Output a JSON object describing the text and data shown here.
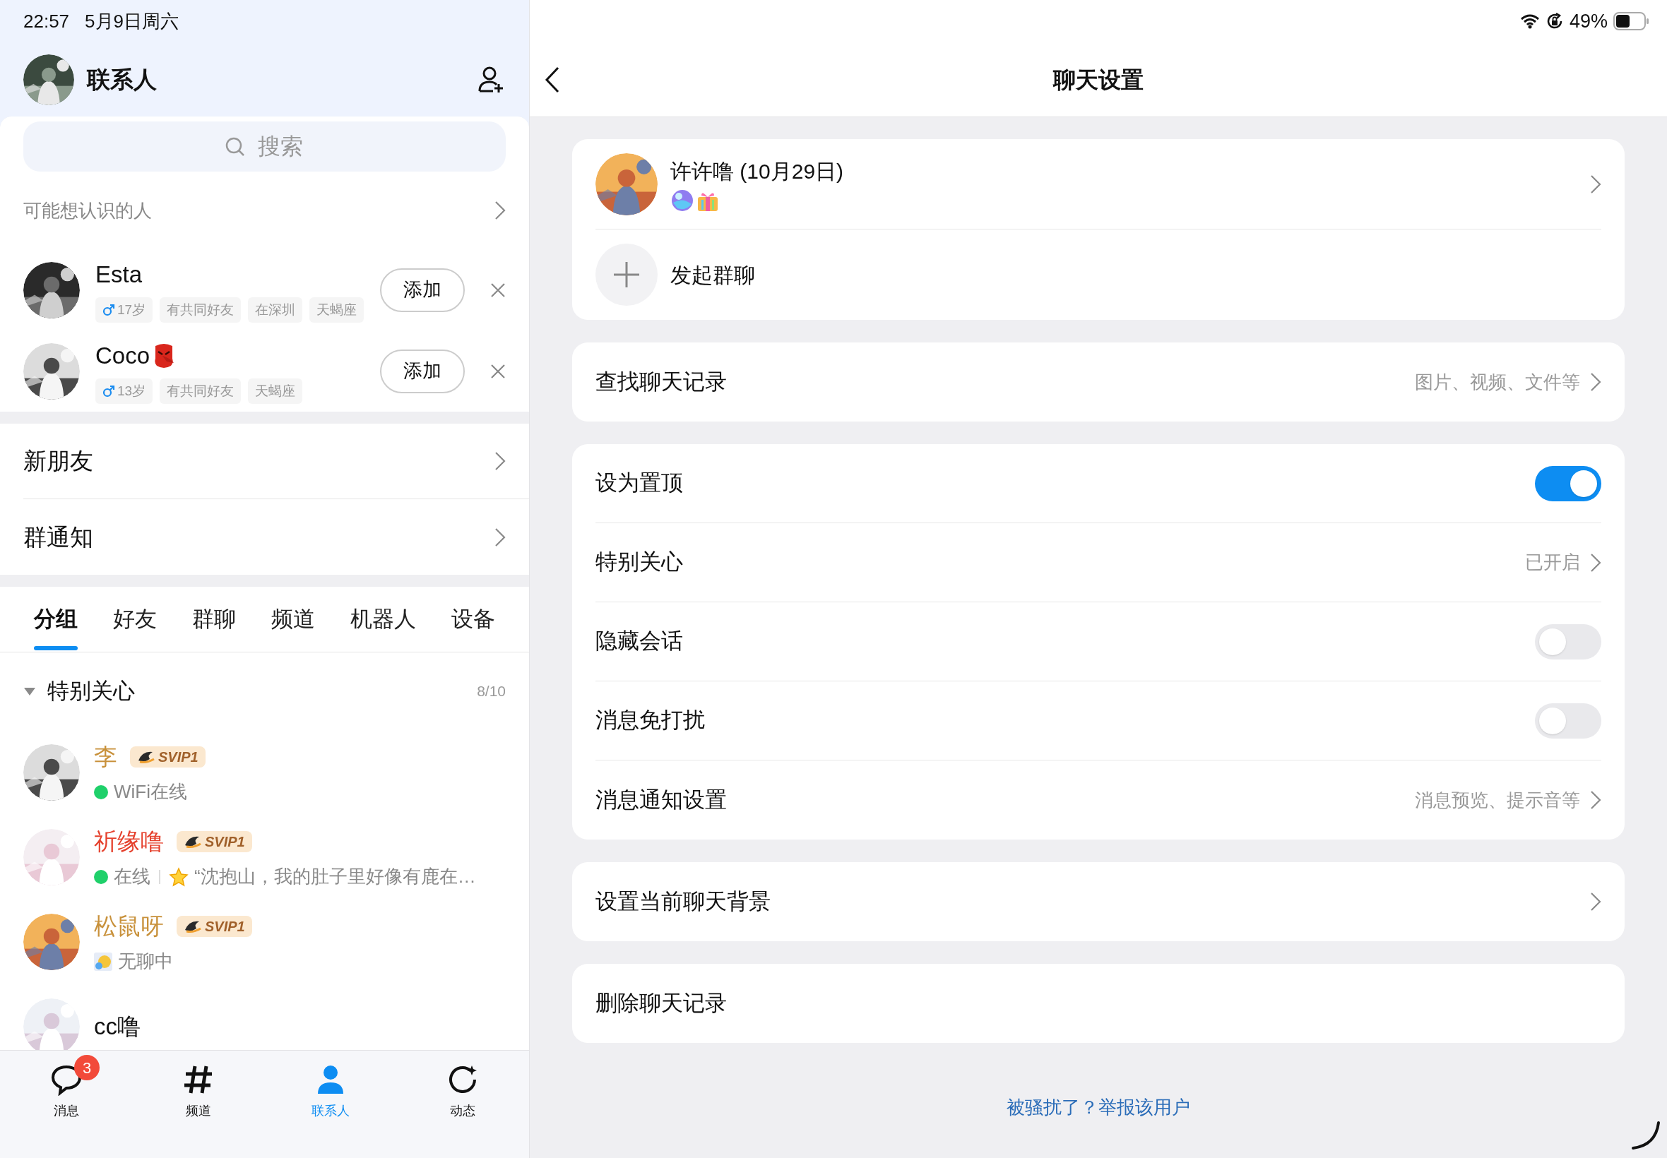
{
  "status_bar": {
    "time": "22:57",
    "date": "5月9日周六",
    "battery_text": "49%"
  },
  "contacts_panel": {
    "title": "联系人",
    "search": {
      "placeholder": "搜索"
    },
    "suggestions": {
      "title": "可能想认识的人",
      "people": [
        {
          "name": "Esta",
          "emoji": false,
          "tags": [
            {
              "kind": "gender",
              "text": "17岁"
            },
            {
              "kind": "plain",
              "text": "有共同好友"
            },
            {
              "kind": "plain",
              "text": "在深圳"
            },
            {
              "kind": "plain",
              "text": "天蝎座"
            }
          ],
          "button": "添加"
        },
        {
          "name": "Coco",
          "emoji": true,
          "tags": [
            {
              "kind": "gender",
              "text": "13岁"
            },
            {
              "kind": "plain",
              "text": "有共同好友"
            },
            {
              "kind": "plain",
              "text": "天蝎座"
            }
          ],
          "button": "添加"
        }
      ]
    },
    "links": [
      {
        "label": "新朋友"
      },
      {
        "label": "群通知"
      }
    ],
    "tabs": [
      {
        "label": "分组",
        "selected": true
      },
      {
        "label": "好友",
        "selected": false
      },
      {
        "label": "群聊",
        "selected": false
      },
      {
        "label": "频道",
        "selected": false
      },
      {
        "label": "机器人",
        "selected": false
      },
      {
        "label": "设备",
        "selected": false
      }
    ],
    "group": {
      "name": "特别关心",
      "count": "8/10",
      "expanded": true,
      "contacts": [
        {
          "name": "李",
          "color": "#c8913b",
          "badge": "SVIP1",
          "status": {
            "kind": "online",
            "text": "WiFi在线"
          }
        },
        {
          "name": "祈缘噜",
          "color": "#e5402c",
          "badge": "SVIP1",
          "status": {
            "kind": "online",
            "text": "在线",
            "signature": "“沈抱山，我的肚子里好像有鹿在…"
          }
        },
        {
          "name": "松鼠呀",
          "color": "#c8913b",
          "badge": "SVIP1",
          "status": {
            "kind": "sleepy",
            "text": "无聊中"
          }
        },
        {
          "name": "cc噜",
          "color": "#111111"
        }
      ]
    }
  },
  "tab_bar": [
    {
      "label": "消息",
      "badge": "3",
      "selected": false
    },
    {
      "label": "频道",
      "selected": false
    },
    {
      "label": "联系人",
      "selected": true
    },
    {
      "label": "动态",
      "selected": false
    }
  ],
  "chat_settings": {
    "title": "聊天设置",
    "groups": [
      [
        {
          "kind": "profile",
          "name": "许许噜 (10月29日)"
        },
        {
          "kind": "action",
          "label": "发起群聊"
        }
      ],
      [
        {
          "kind": "link",
          "label": "查找聊天记录",
          "hint": "图片、视频、文件等"
        }
      ],
      [
        {
          "kind": "toggle",
          "label": "设为置顶",
          "on": true
        },
        {
          "kind": "link",
          "label": "特别关心",
          "hint": "已开启"
        },
        {
          "kind": "toggle",
          "label": "隐藏会话",
          "on": false
        },
        {
          "kind": "toggle",
          "label": "消息免打扰",
          "on": false
        },
        {
          "kind": "link",
          "label": "消息通知设置",
          "hint": "消息预览、提示音等"
        }
      ],
      [
        {
          "kind": "link",
          "label": "设置当前聊天背景"
        }
      ],
      [
        {
          "kind": "plain",
          "label": "删除聊天记录"
        }
      ]
    ],
    "report_link": "被骚扰了？举报该用户"
  }
}
